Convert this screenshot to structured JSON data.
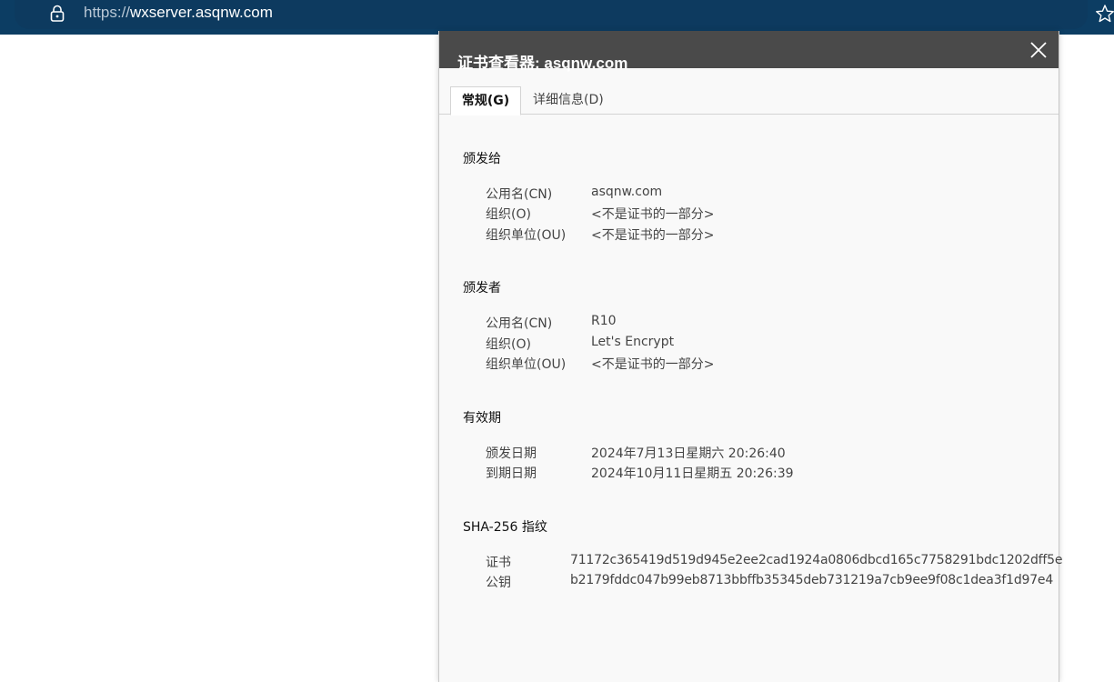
{
  "browser": {
    "url_scheme": "https://",
    "url_host": "wxserver.asqnw.com"
  },
  "dialog": {
    "title": "证书查看器: asqnw.com",
    "tabs": [
      {
        "label": "常规(G)",
        "active": true
      },
      {
        "label": "详细信息(D)",
        "active": false
      }
    ],
    "issued_to": {
      "heading": "颁发给",
      "rows": [
        {
          "label": "公用名(CN)",
          "value": "asqnw.com"
        },
        {
          "label": "组织(O)",
          "value": "<不是证书的一部分>"
        },
        {
          "label": "组织单位(OU)",
          "value": "<不是证书的一部分>"
        }
      ]
    },
    "issued_by": {
      "heading": "颁发者",
      "rows": [
        {
          "label": "公用名(CN)",
          "value": "R10"
        },
        {
          "label": "组织(O)",
          "value": "Let's Encrypt"
        },
        {
          "label": "组织单位(OU)",
          "value": "<不是证书的一部分>"
        }
      ]
    },
    "validity": {
      "heading": "有效期",
      "rows": [
        {
          "label": "颁发日期",
          "value": "2024年7月13日星期六 20:26:40"
        },
        {
          "label": "到期日期",
          "value": "2024年10月11日星期五 20:26:39"
        }
      ]
    },
    "fingerprints": {
      "heading": "SHA-256 指纹",
      "rows": [
        {
          "label": "证书",
          "value": "71172c365419d519d945e2ee2cad1924a0806dbcd165c7758291bdc1202dff5e"
        },
        {
          "label": "公钥",
          "value": "b2179fddc047b99eb8713bbffb35345deb731219a7cb9ee9f08c1dea3f1d97e4"
        }
      ]
    }
  },
  "icons": {
    "lock": "lock-icon",
    "star": "star-icon",
    "close": "close-icon"
  }
}
